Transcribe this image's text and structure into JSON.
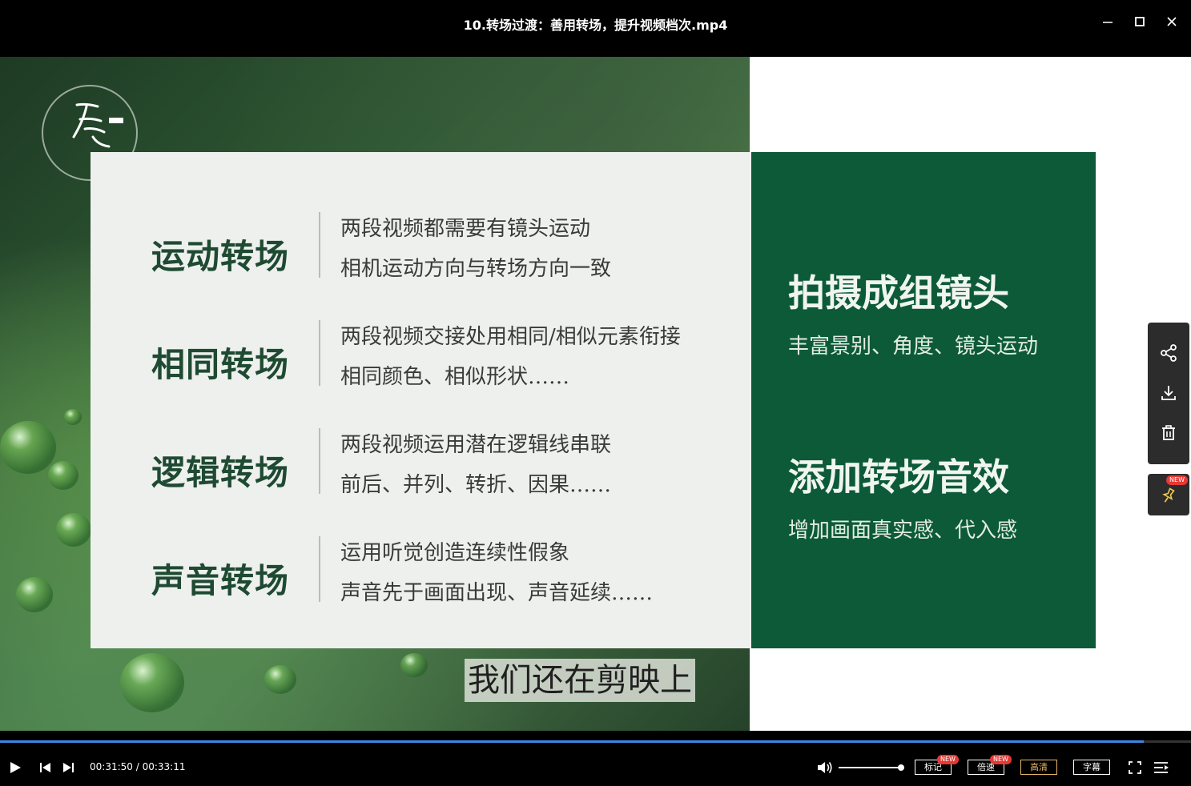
{
  "window": {
    "title": "10.转场过渡：善用转场，提升视频档次.mp4"
  },
  "slide": {
    "rows": [
      {
        "title": "运动转场",
        "line1": "两段视频都需要有镜头运动",
        "line2": "相机运动方向与转场方向一致"
      },
      {
        "title": "相同转场",
        "line1": "两段视频交接处用相同/相似元素衔接",
        "line2": "相同颜色、相似形状……"
      },
      {
        "title": "逻辑转场",
        "line1": "两段视频运用潜在逻辑线串联",
        "line2": "前后、并列、转折、因果……"
      },
      {
        "title": "声音转场",
        "line1": "运用听觉创造连续性假象",
        "line2": "声音先于画面出现、声音延续……"
      }
    ],
    "green": {
      "heading1": "拍摄成组镜头",
      "sub1": "丰富景别、角度、镜头运动",
      "heading2": "添加转场音效",
      "sub2": "增加画面真实感、代入感"
    },
    "subtitle": "我们还在剪映上"
  },
  "sidebar": {
    "icons": [
      "share-icon",
      "download-icon",
      "delete-icon"
    ],
    "pin_badge": "NEW"
  },
  "player": {
    "current_time": "00:31:50",
    "separator": " / ",
    "total_time": "00:33:11",
    "progress": 0.9602,
    "volume": 1.0,
    "buttons": {
      "mark": "标记",
      "speed": "倍速",
      "quality": "高清",
      "subtitle": "字幕"
    },
    "badges": {
      "mark": "NEW",
      "speed": "NEW"
    }
  }
}
